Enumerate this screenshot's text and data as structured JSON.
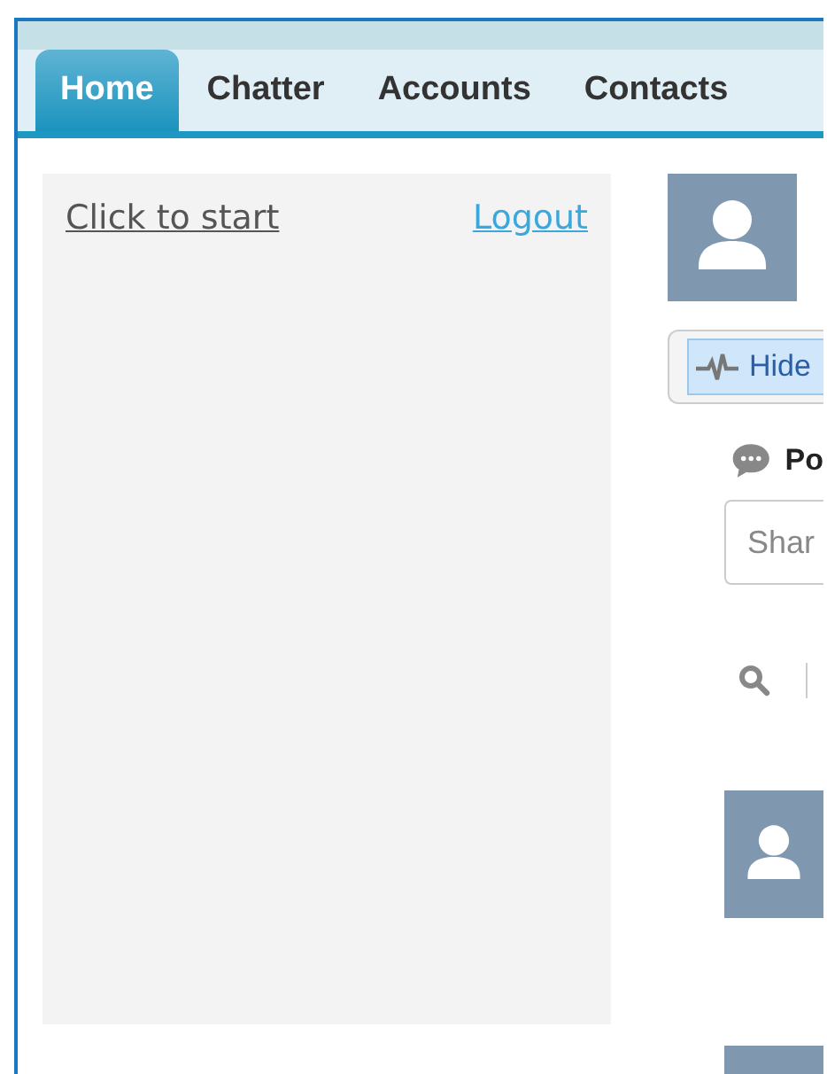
{
  "tabs": [
    {
      "label": "Home",
      "selected": true
    },
    {
      "label": "Chatter",
      "selected": false
    },
    {
      "label": "Accounts",
      "selected": false
    },
    {
      "label": "Contacts",
      "selected": false
    }
  ],
  "sidebar": {
    "start_link": "Click to start",
    "logout_link": "Logout"
  },
  "feed": {
    "hide_button": "Hide",
    "post_tab": "Po",
    "share_field": {
      "placeholder": "Shar"
    }
  }
}
